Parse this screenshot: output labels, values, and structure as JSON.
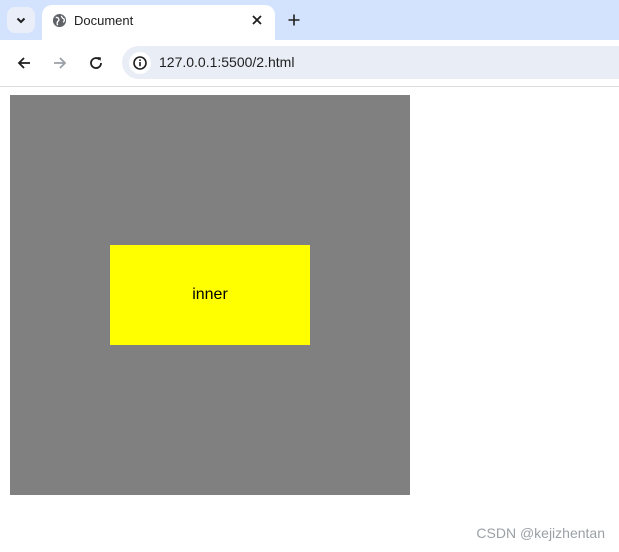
{
  "browser": {
    "tab": {
      "title": "Document"
    },
    "address_bar": {
      "url": "127.0.0.1:5500/2.html"
    }
  },
  "page": {
    "inner_label": "inner",
    "outer_color": "#808080",
    "inner_color": "#ffff00"
  },
  "watermark": "CSDN @kejizhentan",
  "colors": {
    "tabstrip": "#d3e3fd",
    "omnibox": "#e9eef6"
  },
  "icons": [
    "tab-search-icon",
    "globe-icon",
    "close-icon",
    "plus-icon",
    "back-arrow-icon",
    "forward-arrow-icon",
    "reload-icon",
    "info-icon"
  ]
}
